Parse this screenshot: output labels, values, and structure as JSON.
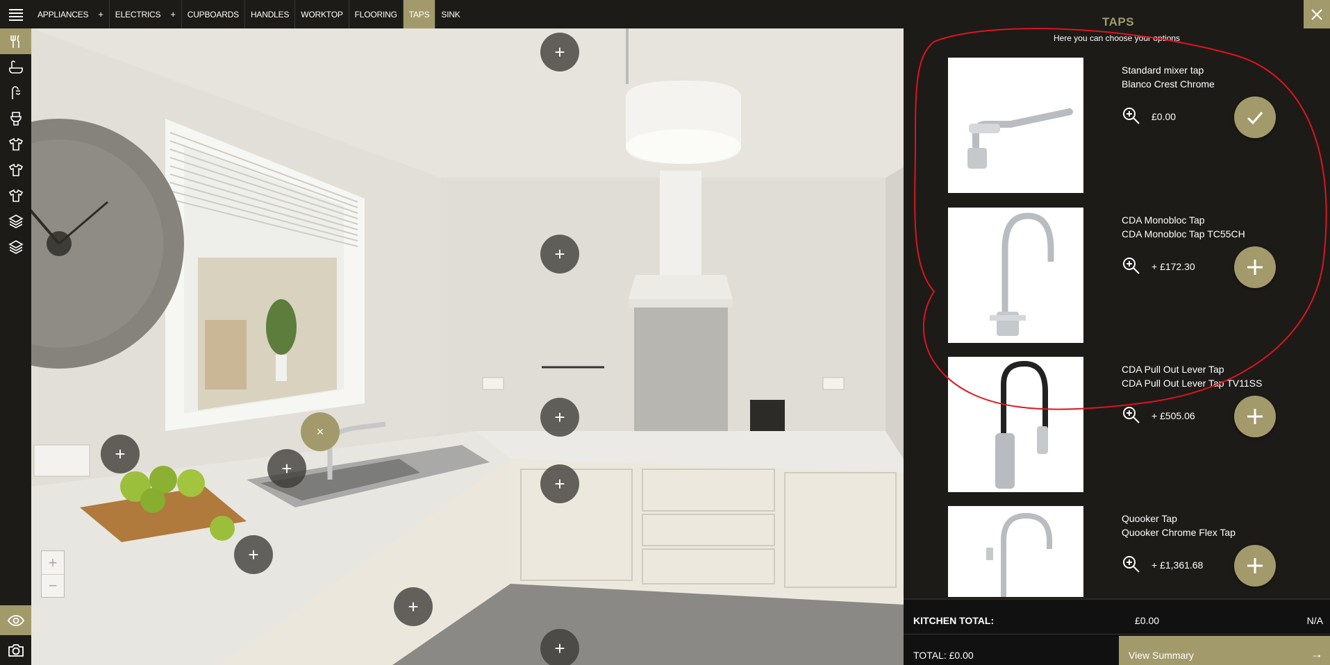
{
  "nav": {
    "items": [
      {
        "label": "APPLIANCES",
        "plus": "+"
      },
      {
        "label": "ELECTRICS",
        "plus": "+"
      },
      {
        "label": "CUPBOARDS"
      },
      {
        "label": "HANDLES"
      },
      {
        "label": "WORKTOP"
      },
      {
        "label": "FLOORING"
      },
      {
        "label": "TAPS",
        "active": true
      },
      {
        "label": "SINK"
      }
    ]
  },
  "sidebar": {
    "icons": [
      "cutlery-icon",
      "bath-icon",
      "shower-icon",
      "toilet-icon",
      "shirt-icon",
      "shirt-icon",
      "shirt-icon",
      "layers-icon",
      "layers-icon"
    ],
    "bottom": [
      "eye-icon",
      "camera-icon"
    ]
  },
  "scene": {
    "zoom_in": "+",
    "zoom_out": "−",
    "hotspot_plus": "+",
    "hotspot_close": "×"
  },
  "panel": {
    "title": "TAPS",
    "subtitle": "Here you can choose your options",
    "options": [
      {
        "name": "Standard mixer tap",
        "model": "Blanco Crest Chrome",
        "price": "£0.00",
        "selected": true
      },
      {
        "name": "CDA Monobloc Tap",
        "model": "CDA Monobloc Tap TC55CH",
        "price": "+ £172.30",
        "selected": false
      },
      {
        "name": "CDA Pull Out Lever Tap",
        "model": "CDA Pull Out Lever Tap TV11SS",
        "price": "+ £505.06",
        "selected": false
      },
      {
        "name": "Quooker Tap",
        "model": "Quooker Chrome Flex Tap",
        "price": "+ £1,361.68",
        "selected": false
      }
    ],
    "kitchen_total_label": "KITCHEN TOTAL:",
    "kitchen_total_value": "£0.00",
    "kitchen_total_na": "N/A",
    "total": "TOTAL: £0.00",
    "view_summary": "View Summary",
    "view_summary_arrow": "→"
  },
  "colors": {
    "accent": "#a39a6c",
    "dark": "#1c1b18",
    "annotation": "#e0141e"
  }
}
